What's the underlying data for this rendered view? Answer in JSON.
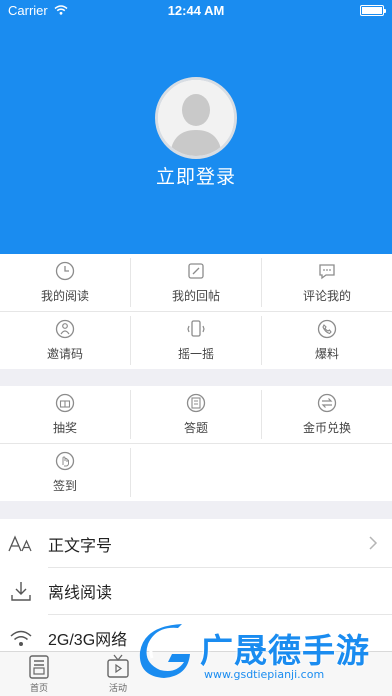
{
  "status_bar": {
    "carrier": "Carrier",
    "time": "12:44 AM"
  },
  "header": {
    "login_label": "立即登录"
  },
  "grid1": {
    "items": [
      {
        "label": "我的阅读",
        "icon": "clock-icon"
      },
      {
        "label": "我的回帖",
        "icon": "edit-icon"
      },
      {
        "label": "评论我的",
        "icon": "comment-icon"
      },
      {
        "label": "邀请码",
        "icon": "invite-icon"
      },
      {
        "label": "摇一摇",
        "icon": "shake-icon"
      },
      {
        "label": "爆料",
        "icon": "phone-icon"
      }
    ]
  },
  "grid2": {
    "items": [
      {
        "label": "抽奖",
        "icon": "gift-icon"
      },
      {
        "label": "答题",
        "icon": "quiz-icon"
      },
      {
        "label": "金币兑换",
        "icon": "exchange-icon"
      },
      {
        "label": "签到",
        "icon": "checkin-icon"
      }
    ]
  },
  "settings": {
    "rows": [
      {
        "label": "正文字号",
        "icon": "font-size-icon"
      },
      {
        "label": "离线阅读",
        "icon": "download-icon"
      },
      {
        "label": "2G/3G网络",
        "icon": "wifi-icon"
      }
    ]
  },
  "tabbar": {
    "tabs": [
      {
        "label": "首页",
        "icon": "home-icon"
      },
      {
        "label": "活动",
        "icon": "tv-icon"
      }
    ]
  },
  "watermark": {
    "text": "广晟德手游",
    "url": "www.gsdtiepianji.com"
  },
  "colors": {
    "accent": "#1a8cf0",
    "background": "#efeff4",
    "icon_gray": "#8c8c8c"
  }
}
